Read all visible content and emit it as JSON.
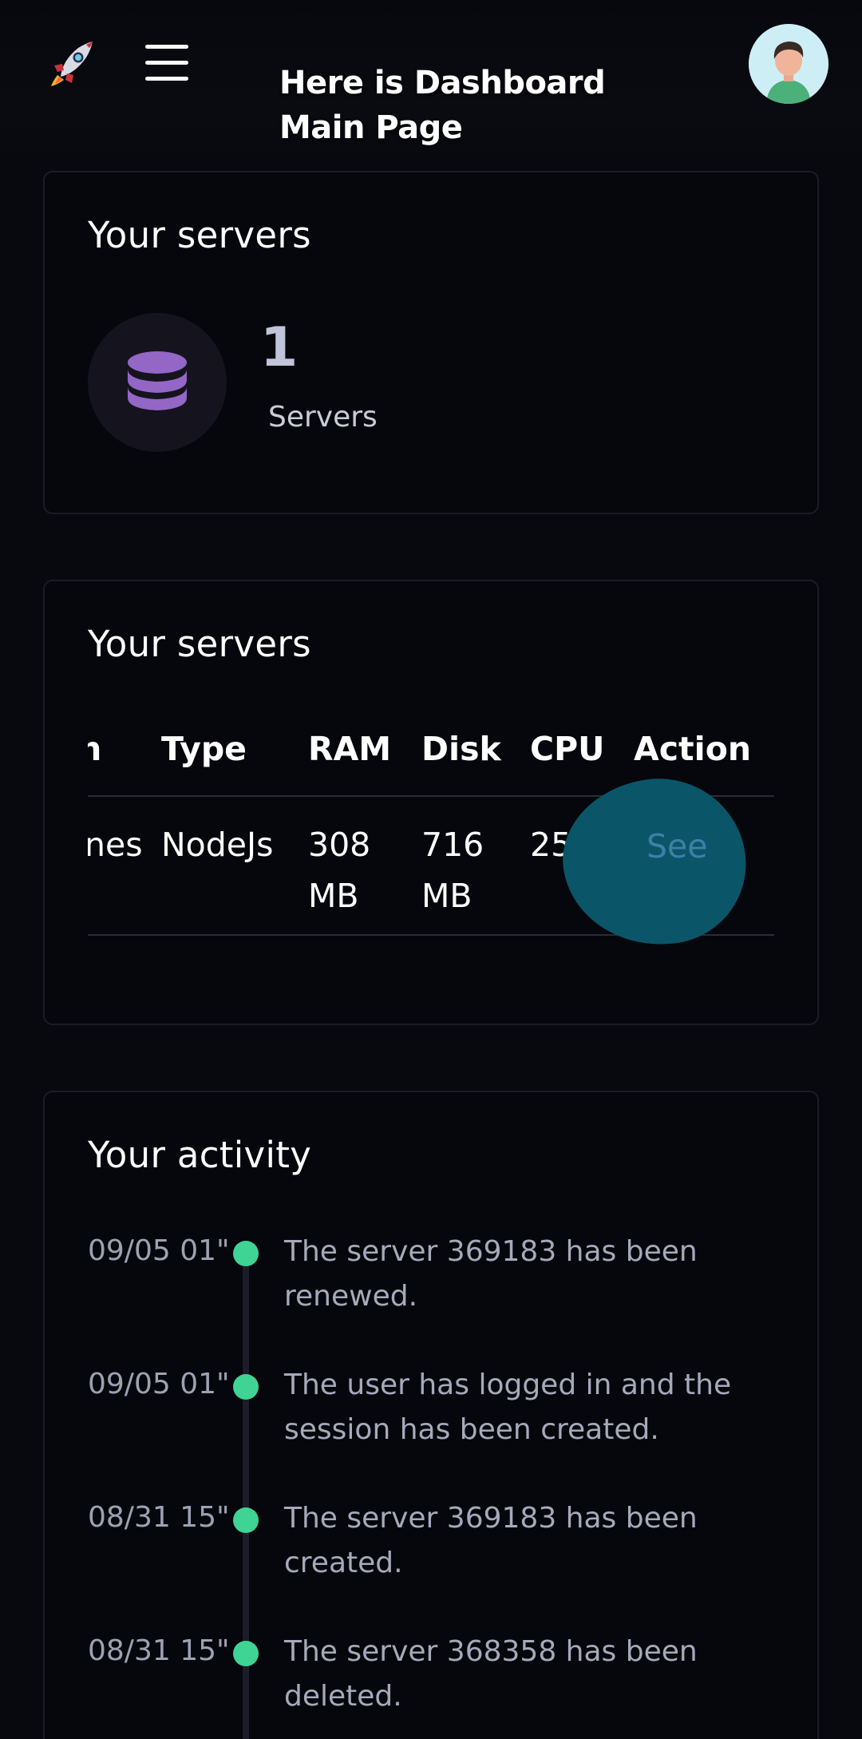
{
  "header": {
    "title_line1": "Here is Dashboard",
    "title_line2": "Main Page",
    "logo_icon": "rocket-icon",
    "menu_icon": "hamburger-menu-icon",
    "avatar_icon": "user-avatar-icon"
  },
  "servers_summary": {
    "title": "Your servers",
    "count": "1",
    "label": "Servers",
    "icon": "database-icon",
    "icon_color": "#9466c6"
  },
  "servers_table": {
    "title": "Your servers",
    "columns": [
      "on",
      "Type",
      "RAM",
      "Disk",
      "CPU",
      "Action"
    ],
    "rows": [
      {
        "name": "nes",
        "type": "NodeJs",
        "ram_line1": "308",
        "ram_line2": "MB",
        "disk_line1": "716",
        "disk_line2": "MB",
        "cpu": "25%",
        "action": "See"
      }
    ]
  },
  "activity": {
    "title": "Your activity",
    "dot_color": "#3fd394",
    "items": [
      {
        "time": "09/05 01\"",
        "text": "The server 369183 has been renewed."
      },
      {
        "time": "09/05 01\"",
        "text": "The user has logged in and the session has been created."
      },
      {
        "time": "08/31 15\"",
        "text": "The server 369183 has been created."
      },
      {
        "time": "08/31 15\"",
        "text": "The server 368358 has been deleted."
      }
    ]
  }
}
